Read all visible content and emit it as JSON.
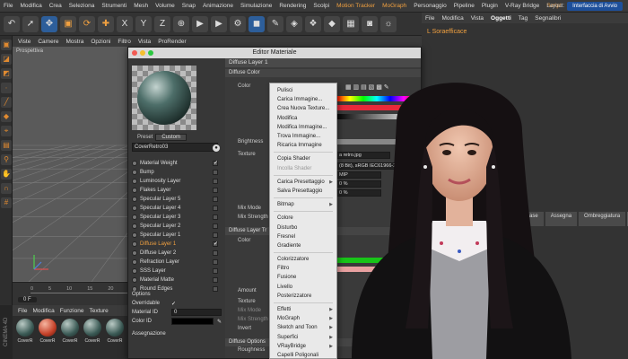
{
  "window_title": "Books.c4d * - Principale",
  "menubar": [
    "File",
    "Modifica",
    "Crea",
    "Seleziona",
    "Strumenti",
    "Mesh",
    "Volume",
    "Snap",
    "Animazione",
    "Simulazione",
    "Rendering",
    "Scolpi",
    "Motion Tracker",
    "MoGraph",
    "Personaggio",
    "Pipeline",
    "Plugin",
    "V-Ray Bridge",
    "Script",
    "Finestre",
    "Aiuto"
  ],
  "layout_label": "Layout:",
  "layout_value": "Interfaccia di Avvio",
  "viewport": {
    "menu": [
      "Viste",
      "Camere",
      "Mostra",
      "Opzioni",
      "Filtro",
      "Vista",
      "ProRender"
    ],
    "label": "Prospettiva"
  },
  "timeline": {
    "ticks": [
      "0",
      "5",
      "10",
      "15",
      "20",
      "25",
      "30",
      "35",
      "40",
      "45",
      "50",
      "55",
      "60",
      "65",
      "70",
      "75",
      "80",
      "85",
      "90"
    ],
    "frame": "0 F"
  },
  "material_manager": {
    "menu": [
      "File",
      "Modifica",
      "Funzione",
      "Texture"
    ],
    "swatches": [
      "CoverR",
      "CoverR",
      "CoverR",
      "CoverR",
      "CoverR"
    ]
  },
  "cinema_label": "CINEMA 4D",
  "right_panel": {
    "menu": [
      "File",
      "Modifica",
      "Vista",
      "Oggetti",
      "Tag",
      "Segnalibri"
    ],
    "object_name": "L Soraefficace",
    "tabs": [
      "Base",
      "Assegna",
      "Ombreggiatura",
      "Material Weight"
    ]
  },
  "editor": {
    "title": "Editor Materiale",
    "preset_label": "Preset",
    "preset_value": "Custom",
    "material_name": "CoverRetro03",
    "channels": [
      {
        "label": "Material Weight",
        "checked": true
      },
      {
        "label": "Bump",
        "checked": false
      },
      {
        "label": "Luminosity Layer",
        "checked": false
      },
      {
        "label": "Flakes Layer",
        "checked": false
      },
      {
        "label": "Specular Layer 5",
        "checked": false
      },
      {
        "label": "Specular Layer 4",
        "checked": false
      },
      {
        "label": "Specular Layer 3",
        "checked": false
      },
      {
        "label": "Specular Layer 2",
        "checked": false
      },
      {
        "label": "Specular Layer 1",
        "checked": false
      },
      {
        "label": "Diffuse Layer 1",
        "checked": true,
        "selected": true
      },
      {
        "label": "Diffuse Layer 2",
        "checked": false
      },
      {
        "label": "Refraction Layer",
        "checked": false
      },
      {
        "label": "SSS Layer",
        "checked": false
      },
      {
        "label": "Material Matte",
        "checked": false
      },
      {
        "label": "Round Edges",
        "checked": false
      }
    ],
    "options": {
      "title": "Options",
      "overridable": "Overridable",
      "material_id": "Material ID",
      "material_id_value": "0",
      "color_id": "Color ID",
      "assign": "Assegnazione"
    },
    "right": {
      "header": "Diffuse Layer 1",
      "section1": "Diffuse Color",
      "color_label": "Color",
      "brightness_label": "Brightness",
      "texture_label": "Texture",
      "texture_file": "a retro.jpg",
      "texture_info": "(8 Bit), sRGB IEC61966-2.1",
      "mip_label": "MIP",
      "pct1": "0 %",
      "pct2": "0 %",
      "mixmode_label": "Mix Mode",
      "mixstrength_label": "Mix Strength",
      "section2": "Diffuse Layer Tr",
      "color2_label": "Color",
      "amount_label": "Amount",
      "texture2_label": "Texture",
      "mixmode2_label": "Mix Mode",
      "mixstrength2_label": "Mix Strength",
      "invert_label": "Invert",
      "section3": "Diffuse Options",
      "roughness_label": "Roughness"
    }
  },
  "context_menu": [
    {
      "label": "Pulisci",
      "dim": false,
      "arrow": false
    },
    {
      "label": "Carica Immagine...",
      "dim": false,
      "arrow": false
    },
    {
      "label": "Crea Nuova Texture...",
      "dim": false,
      "arrow": false
    },
    {
      "label": "Modifica",
      "dim": false,
      "arrow": false
    },
    {
      "label": "Modifica Immagine...",
      "dim": false,
      "arrow": false
    },
    {
      "label": "Trova Immagine...",
      "dim": false,
      "arrow": false
    },
    {
      "label": "Ricarica Immagine",
      "dim": false,
      "arrow": false
    },
    {
      "sep": true
    },
    {
      "label": "Copia Shader",
      "dim": false,
      "arrow": false
    },
    {
      "label": "Incolla Shader",
      "dim": true,
      "arrow": false
    },
    {
      "sep": true
    },
    {
      "label": "Carica Presettaggio",
      "dim": false,
      "arrow": true
    },
    {
      "label": "Salva Presettaggio",
      "dim": false,
      "arrow": false
    },
    {
      "sep": true
    },
    {
      "label": "Bitmap",
      "dim": false,
      "arrow": true
    },
    {
      "sep": true
    },
    {
      "label": "Colore",
      "dim": false,
      "arrow": false
    },
    {
      "label": "Disturbo",
      "dim": false,
      "arrow": false
    },
    {
      "label": "Fresnel",
      "dim": false,
      "arrow": false
    },
    {
      "label": "Gradiente",
      "dim": false,
      "arrow": false
    },
    {
      "sep": true
    },
    {
      "label": "Colorizzatore",
      "dim": false,
      "arrow": false
    },
    {
      "label": "Filtro",
      "dim": false,
      "arrow": false
    },
    {
      "label": "Fusione",
      "dim": false,
      "arrow": false
    },
    {
      "label": "Livello",
      "dim": false,
      "arrow": false
    },
    {
      "label": "Posterizzatore",
      "dim": false,
      "arrow": false
    },
    {
      "sep": true
    },
    {
      "label": "Effetti",
      "dim": false,
      "arrow": true
    },
    {
      "label": "MoGraph",
      "dim": false,
      "arrow": true
    },
    {
      "label": "Sketch and Toon",
      "dim": false,
      "arrow": true
    },
    {
      "label": "Superfici",
      "dim": false,
      "arrow": true
    },
    {
      "label": "VRayBridge",
      "dim": false,
      "arrow": true
    },
    {
      "label": "Capelli Poligonali",
      "dim": false,
      "arrow": false
    }
  ],
  "colors": {
    "accent_orange": "#f0a040",
    "layout_blue": "#1d4f9a"
  }
}
